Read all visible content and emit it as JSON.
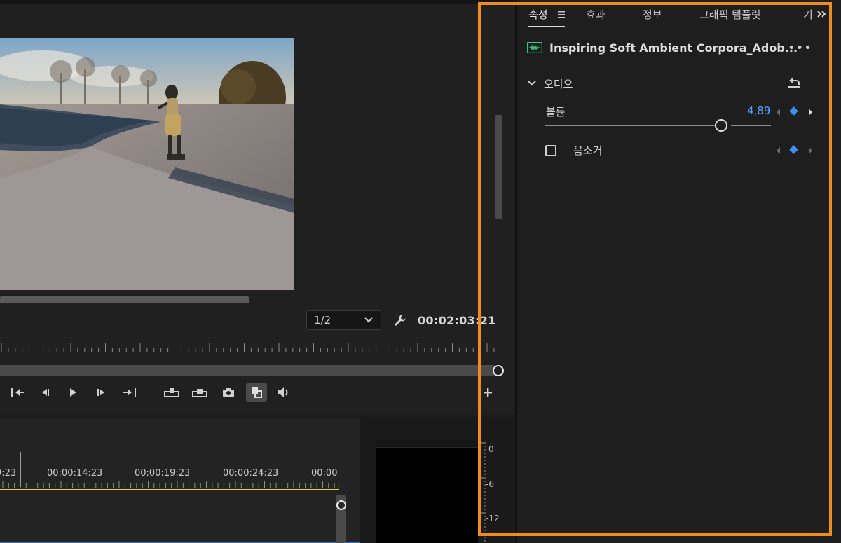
{
  "monitor": {
    "resolution": {
      "value": "1/2"
    },
    "timecode": "00:02:03:21"
  },
  "timeline": {
    "ruler_labels": [
      "9:23",
      "00:00:14:23",
      "00:00:19:23",
      "00:00:24:23",
      "00:00"
    ]
  },
  "meter": {
    "db_labels": [
      "0",
      "-6",
      "-12"
    ]
  },
  "panel": {
    "tabs": [
      "속성",
      "효과",
      "정보",
      "그래픽 템플릿",
      "기"
    ],
    "clip_name": "Inspiring Soft Ambient Corpora_Adob...",
    "more_label": "•••",
    "section_title": "오디오",
    "volume": {
      "label": "볼륨",
      "value": "4,89",
      "level": 0.78
    },
    "mute": {
      "label": "음소거",
      "checked": false
    }
  },
  "colors": {
    "highlight": "#f08c1c",
    "accent_blue": "#4da3ff",
    "keyframe_blue": "#3d8ef0",
    "timeline_yellow": "#e6d22a"
  }
}
